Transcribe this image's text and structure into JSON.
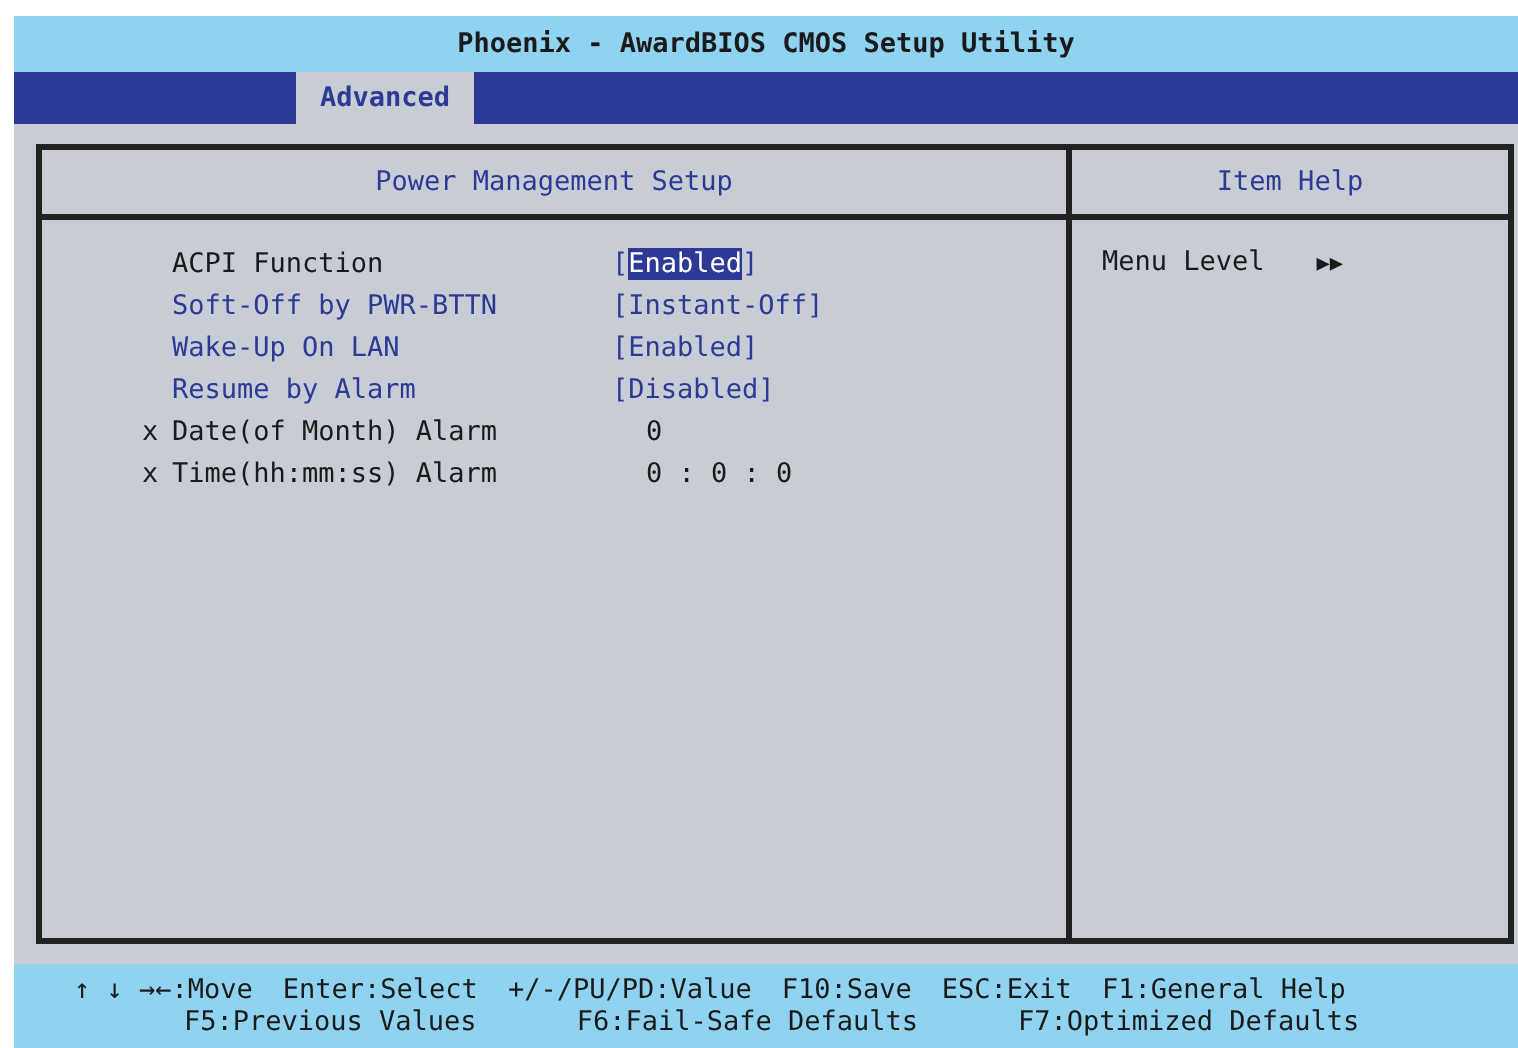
{
  "window": {
    "title": "Phoenix - AwardBIOS CMOS Setup Utility"
  },
  "tabs": [
    {
      "label": "Advanced",
      "selected": true
    }
  ],
  "main_panel": {
    "title": "Power Management Setup",
    "items": [
      {
        "kind": "option",
        "label": "ACPI Function",
        "open": "[",
        "value": "Enabled",
        "close": "]",
        "selected": true
      },
      {
        "kind": "option",
        "label": "Soft-Off by PWR-BTTN",
        "open": "[",
        "value": "Instant-Off",
        "close": "]",
        "selected": false
      },
      {
        "kind": "option",
        "label": "Wake-Up On LAN",
        "open": "[",
        "value": "Enabled",
        "close": "]",
        "selected": false
      },
      {
        "kind": "option",
        "label": "Resume by Alarm",
        "open": "[",
        "value": "Disabled",
        "close": "]",
        "selected": false
      },
      {
        "kind": "locked",
        "marker": "x",
        "label": "Date(of Month) Alarm",
        "value": "0",
        "selected": false
      },
      {
        "kind": "locked",
        "marker": "x",
        "label": "Time(hh:mm:ss) Alarm",
        "value": "0 : 0 : 0",
        "selected": false
      }
    ]
  },
  "help_panel": {
    "title": "Item Help",
    "label": "Menu Level",
    "icon_text": "▶▶"
  },
  "status_bar": [
    [
      "↑ ↓ →←:Move",
      "Enter:Select",
      "+/-/PU/PD:Value",
      "F10:Save",
      "ESC:Exit",
      "F1:General Help"
    ],
    [
      "F5:Previous Values",
      "F6:Fail-Safe Defaults",
      "F7:Optimized Defaults"
    ]
  ]
}
